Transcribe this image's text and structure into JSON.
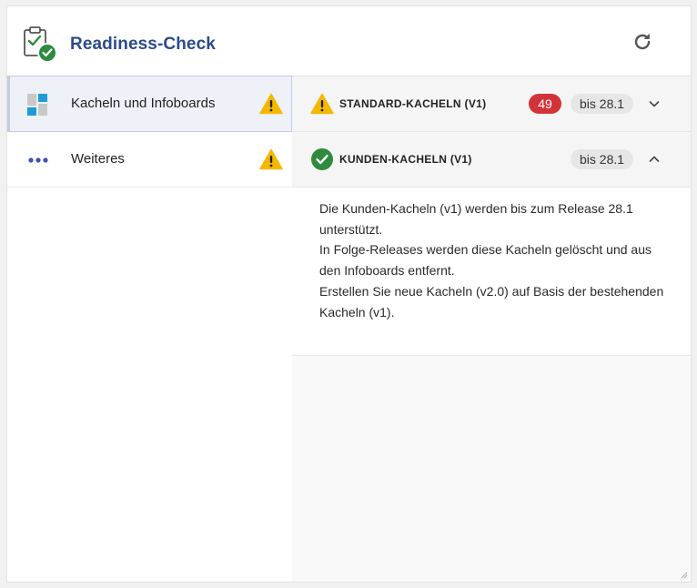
{
  "header": {
    "title": "Readiness-Check",
    "icons": {
      "app": "clipboard-check-icon",
      "refresh": "refresh-icon"
    }
  },
  "sidebar": {
    "items": [
      {
        "label": "Kacheln und Infoboards",
        "icon": "tiles-icon",
        "status": "warning",
        "active": true
      },
      {
        "label": "Weiteres",
        "icon": "more-dots-icon",
        "status": "warning",
        "active": false
      }
    ]
  },
  "sections": [
    {
      "title": "STANDARD-KACHELN (V1)",
      "status": "warning",
      "count": "49",
      "until": "bis 28.1",
      "expanded": false
    },
    {
      "title": "KUNDEN-KACHELN (V1)",
      "status": "ok",
      "until": "bis 28.1",
      "expanded": true,
      "details": [
        "Die Kunden-Kacheln (v1) werden bis zum Release 28.1 unterstützt.",
        "In Folge-Releases werden diese Kacheln gelöscht und aus den Infoboards entfernt.",
        "Erstellen Sie neue Kacheln (v2.0) auf Basis der bestehenden Kacheln (v1)."
      ]
    }
  ],
  "colors": {
    "accent": "#2b4b8c",
    "warning": "#f5b800",
    "success": "#2e8b3e",
    "danger": "#d13438",
    "tiles_blue": "#1e9bd7"
  }
}
